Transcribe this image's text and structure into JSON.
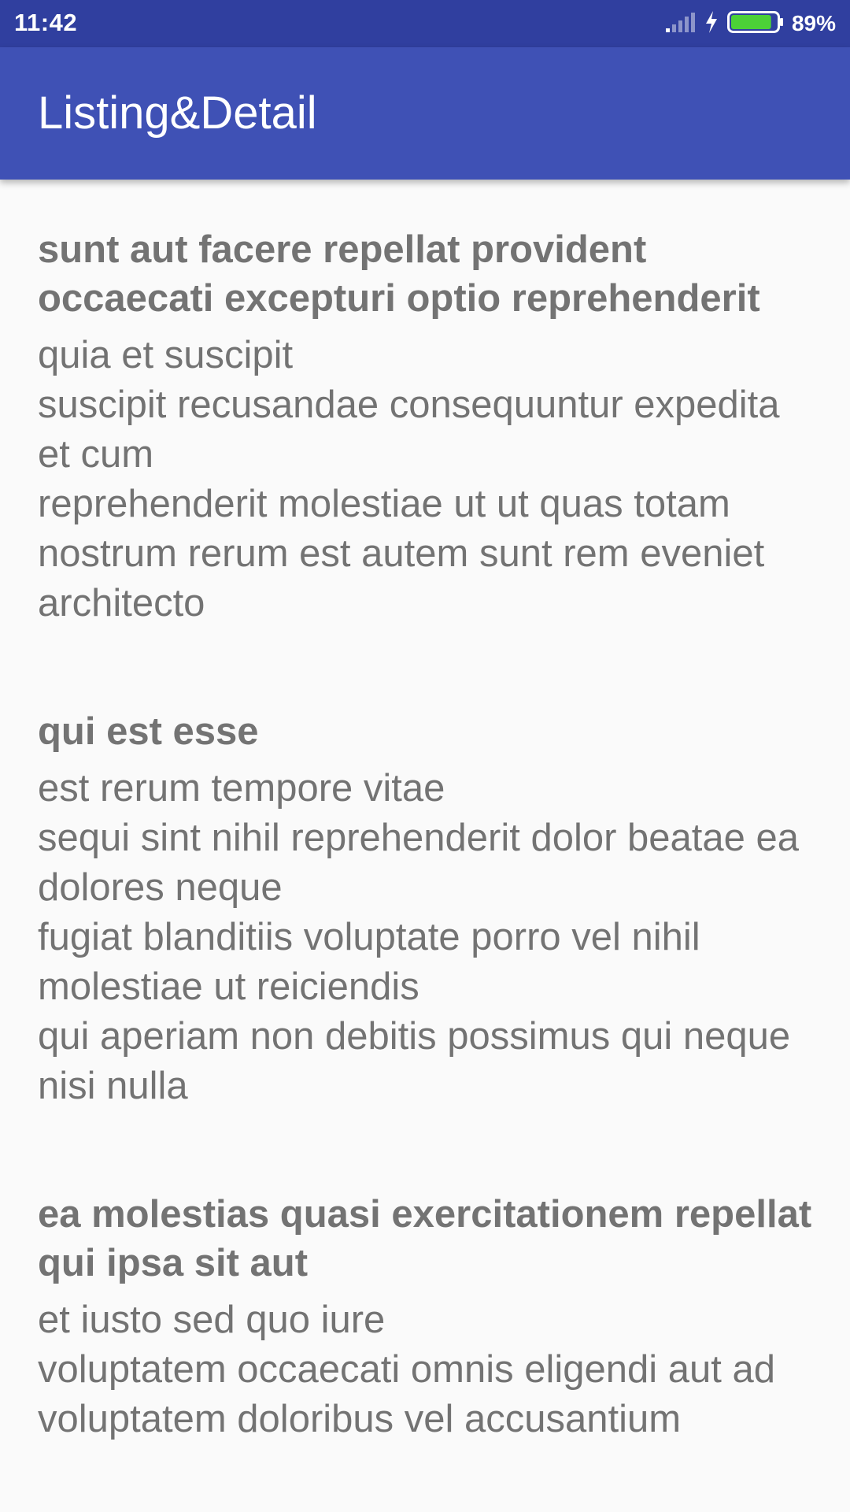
{
  "status_bar": {
    "time": "11:42",
    "battery_percent": "89%",
    "battery_level": 0.89,
    "icons": [
      "signal-icon",
      "charging-icon",
      "battery-icon"
    ],
    "battery_color": "#4cd137"
  },
  "app_bar": {
    "title": "Listing&Detail",
    "color": "#3f51b5"
  },
  "posts": [
    {
      "title": "sunt aut facere repellat provident occaecati excepturi optio reprehenderit",
      "body": "quia et suscipit\nsuscipit recusandae consequuntur expedita et cum\nreprehenderit molestiae ut ut quas totam\nnostrum rerum est autem sunt rem eveniet architecto"
    },
    {
      "title": "qui est esse",
      "body": "est rerum tempore vitae\nsequi sint nihil reprehenderit dolor beatae ea dolores neque\nfugiat blanditiis voluptate porro vel nihil molestiae ut reiciendis\nqui aperiam non debitis possimus qui neque nisi nulla"
    },
    {
      "title": "ea molestias quasi exercitationem repellat qui ipsa sit aut",
      "body": "et iusto sed quo iure\nvoluptatem occaecati omnis eligendi aut ad\nvoluptatem doloribus vel accusantium"
    }
  ]
}
